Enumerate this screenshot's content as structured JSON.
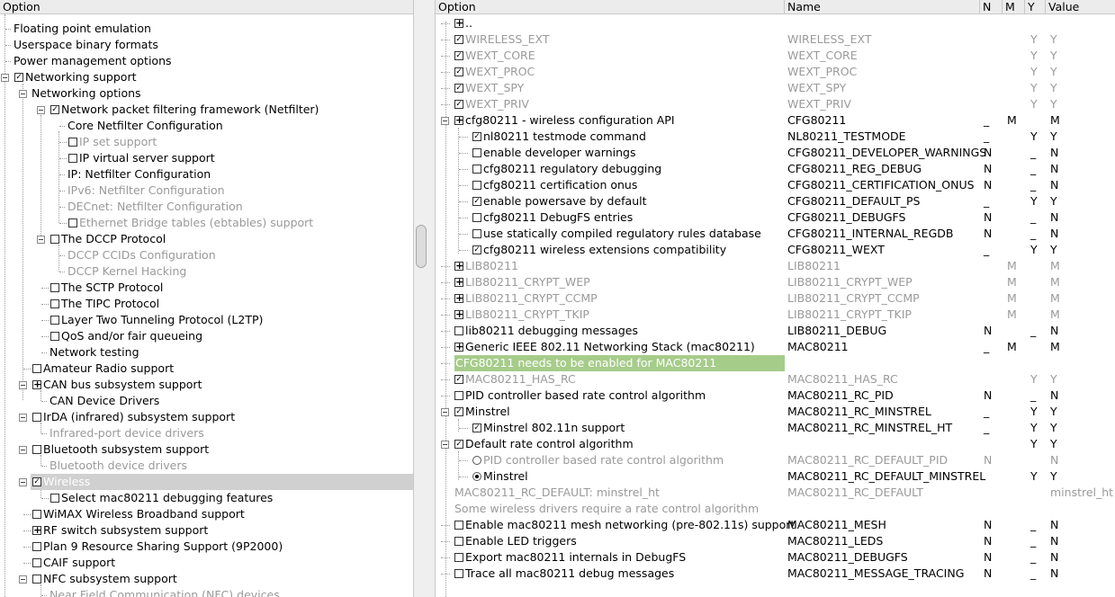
{
  "left_header": "Option",
  "right_header": {
    "option": "Option",
    "name": "Name",
    "n": "N",
    "m": "M",
    "y": "Y",
    "value": "Value"
  },
  "left_rows": [
    {
      "label": "Floating point emulation"
    },
    {
      "label": "Userspace binary formats"
    },
    {
      "label": "Power management options"
    },
    {
      "label": "Networking support"
    },
    {
      "label": "Networking options"
    },
    {
      "label": "Network packet filtering framework (Netfilter)"
    },
    {
      "label": "Core Netfilter Configuration"
    },
    {
      "label": "IP set support"
    },
    {
      "label": "IP virtual server support"
    },
    {
      "label": "IP: Netfilter Configuration"
    },
    {
      "label": "IPv6: Netfilter Configuration"
    },
    {
      "label": "DECnet: Netfilter Configuration"
    },
    {
      "label": "Ethernet Bridge tables (ebtables) support"
    },
    {
      "label": "The DCCP Protocol"
    },
    {
      "label": "DCCP CCIDs Configuration"
    },
    {
      "label": "DCCP Kernel Hacking"
    },
    {
      "label": "The SCTP Protocol"
    },
    {
      "label": "The TIPC Protocol"
    },
    {
      "label": "Layer Two Tunneling Protocol (L2TP)"
    },
    {
      "label": "QoS and/or fair queueing"
    },
    {
      "label": "Network testing"
    },
    {
      "label": "Amateur Radio support"
    },
    {
      "label": "CAN bus subsystem support"
    },
    {
      "label": "CAN Device Drivers"
    },
    {
      "label": "IrDA (infrared) subsystem support"
    },
    {
      "label": "Infrared-port device drivers"
    },
    {
      "label": "Bluetooth subsystem support"
    },
    {
      "label": "Bluetooth device drivers"
    },
    {
      "label": "Wireless"
    },
    {
      "label": "Select mac80211 debugging features"
    },
    {
      "label": "WiMAX Wireless Broadband support"
    },
    {
      "label": "RF switch subsystem support"
    },
    {
      "label": "Plan 9 Resource Sharing Support (9P2000)"
    },
    {
      "label": "CAIF support"
    },
    {
      "label": "NFC subsystem support"
    },
    {
      "label": "Near Field Communication (NFC) devices"
    }
  ],
  "right_rows": [
    {
      "option": "..",
      "name": "",
      "n": "",
      "m": "",
      "y": "",
      "value": ""
    },
    {
      "option": "WIRELESS_EXT",
      "name": "WIRELESS_EXT",
      "n": "",
      "m": "",
      "y": "Y",
      "value": "Y"
    },
    {
      "option": "WEXT_CORE",
      "name": "WEXT_CORE",
      "n": "",
      "m": "",
      "y": "Y",
      "value": "Y"
    },
    {
      "option": "WEXT_PROC",
      "name": "WEXT_PROC",
      "n": "",
      "m": "",
      "y": "Y",
      "value": "Y"
    },
    {
      "option": "WEXT_SPY",
      "name": "WEXT_SPY",
      "n": "",
      "m": "",
      "y": "Y",
      "value": "Y"
    },
    {
      "option": "WEXT_PRIV",
      "name": "WEXT_PRIV",
      "n": "",
      "m": "",
      "y": "Y",
      "value": "Y"
    },
    {
      "option": "cfg80211 - wireless configuration API",
      "name": "CFG80211",
      "n": "_",
      "m": "M",
      "y": "",
      "value": "M"
    },
    {
      "option": "nl80211 testmode command",
      "name": "NL80211_TESTMODE",
      "n": "_",
      "m": "",
      "y": "Y",
      "value": "Y"
    },
    {
      "option": "enable developer warnings",
      "name": "CFG80211_DEVELOPER_WARNINGS",
      "n": "N",
      "m": "",
      "y": "_",
      "value": "N"
    },
    {
      "option": "cfg80211 regulatory debugging",
      "name": "CFG80211_REG_DEBUG",
      "n": "N",
      "m": "",
      "y": "_",
      "value": "N"
    },
    {
      "option": "cfg80211 certification onus",
      "name": "CFG80211_CERTIFICATION_ONUS",
      "n": "N",
      "m": "",
      "y": "_",
      "value": "N"
    },
    {
      "option": "enable powersave by default",
      "name": "CFG80211_DEFAULT_PS",
      "n": "_",
      "m": "",
      "y": "Y",
      "value": "Y"
    },
    {
      "option": "cfg80211 DebugFS entries",
      "name": "CFG80211_DEBUGFS",
      "n": "N",
      "m": "",
      "y": "_",
      "value": "N"
    },
    {
      "option": "use statically compiled regulatory rules database",
      "name": "CFG80211_INTERNAL_REGDB",
      "n": "N",
      "m": "",
      "y": "_",
      "value": "N"
    },
    {
      "option": "cfg80211 wireless extensions compatibility",
      "name": "CFG80211_WEXT",
      "n": "_",
      "m": "",
      "y": "Y",
      "value": "Y"
    },
    {
      "option": "LIB80211",
      "name": "LIB80211",
      "n": "",
      "m": "M",
      "y": "",
      "value": "M"
    },
    {
      "option": "LIB80211_CRYPT_WEP",
      "name": "LIB80211_CRYPT_WEP",
      "n": "",
      "m": "M",
      "y": "",
      "value": "M"
    },
    {
      "option": "LIB80211_CRYPT_CCMP",
      "name": "LIB80211_CRYPT_CCMP",
      "n": "",
      "m": "M",
      "y": "",
      "value": "M"
    },
    {
      "option": "LIB80211_CRYPT_TKIP",
      "name": "LIB80211_CRYPT_TKIP",
      "n": "",
      "m": "M",
      "y": "",
      "value": "M"
    },
    {
      "option": "lib80211 debugging messages",
      "name": "LIB80211_DEBUG",
      "n": "N",
      "m": "",
      "y": "_",
      "value": "N"
    },
    {
      "option": "Generic IEEE 802.11 Networking Stack (mac80211)",
      "name": "MAC80211",
      "n": "_",
      "m": "M",
      "y": "",
      "value": "M"
    },
    {
      "option": "CFG80211 needs to be enabled for MAC80211",
      "name": "",
      "n": "",
      "m": "",
      "y": "",
      "value": ""
    },
    {
      "option": "MAC80211_HAS_RC",
      "name": "MAC80211_HAS_RC",
      "n": "",
      "m": "",
      "y": "Y",
      "value": "Y"
    },
    {
      "option": "PID controller based rate control algorithm",
      "name": "MAC80211_RC_PID",
      "n": "N",
      "m": "",
      "y": "_",
      "value": "N"
    },
    {
      "option": "Minstrel",
      "name": "MAC80211_RC_MINSTREL",
      "n": "_",
      "m": "",
      "y": "Y",
      "value": "Y"
    },
    {
      "option": "Minstrel 802.11n support",
      "name": "MAC80211_RC_MINSTREL_HT",
      "n": "_",
      "m": "",
      "y": "Y",
      "value": "Y"
    },
    {
      "option": "Default rate control algorithm",
      "name": "",
      "n": "",
      "m": "",
      "y": "Y",
      "value": "Y"
    },
    {
      "option": "PID controller based rate control algorithm",
      "name": "MAC80211_RC_DEFAULT_PID",
      "n": "N",
      "m": "",
      "y": "",
      "value": "N"
    },
    {
      "option": "Minstrel",
      "name": "MAC80211_RC_DEFAULT_MINSTREL",
      "n": "",
      "m": "",
      "y": "Y",
      "value": "Y"
    },
    {
      "option": "MAC80211_RC_DEFAULT: minstrel_ht",
      "name": "MAC80211_RC_DEFAULT",
      "n": "",
      "m": "",
      "y": "",
      "value": "minstrel_ht"
    },
    {
      "option": "Some wireless drivers require a rate control algorithm",
      "name": "",
      "n": "",
      "m": "",
      "y": "",
      "value": ""
    },
    {
      "option": "Enable mac80211 mesh networking (pre-802.11s) support",
      "name": "MAC80211_MESH",
      "n": "N",
      "m": "",
      "y": "_",
      "value": "N"
    },
    {
      "option": "Enable LED triggers",
      "name": "MAC80211_LEDS",
      "n": "N",
      "m": "",
      "y": "_",
      "value": "N"
    },
    {
      "option": "Export mac80211 internals in DebugFS",
      "name": "MAC80211_DEBUGFS",
      "n": "N",
      "m": "",
      "y": "_",
      "value": "N"
    },
    {
      "option": "Trace all mac80211 debug messages",
      "name": "MAC80211_MESSAGE_TRACING",
      "n": "N",
      "m": "",
      "y": "_",
      "value": "N"
    }
  ]
}
